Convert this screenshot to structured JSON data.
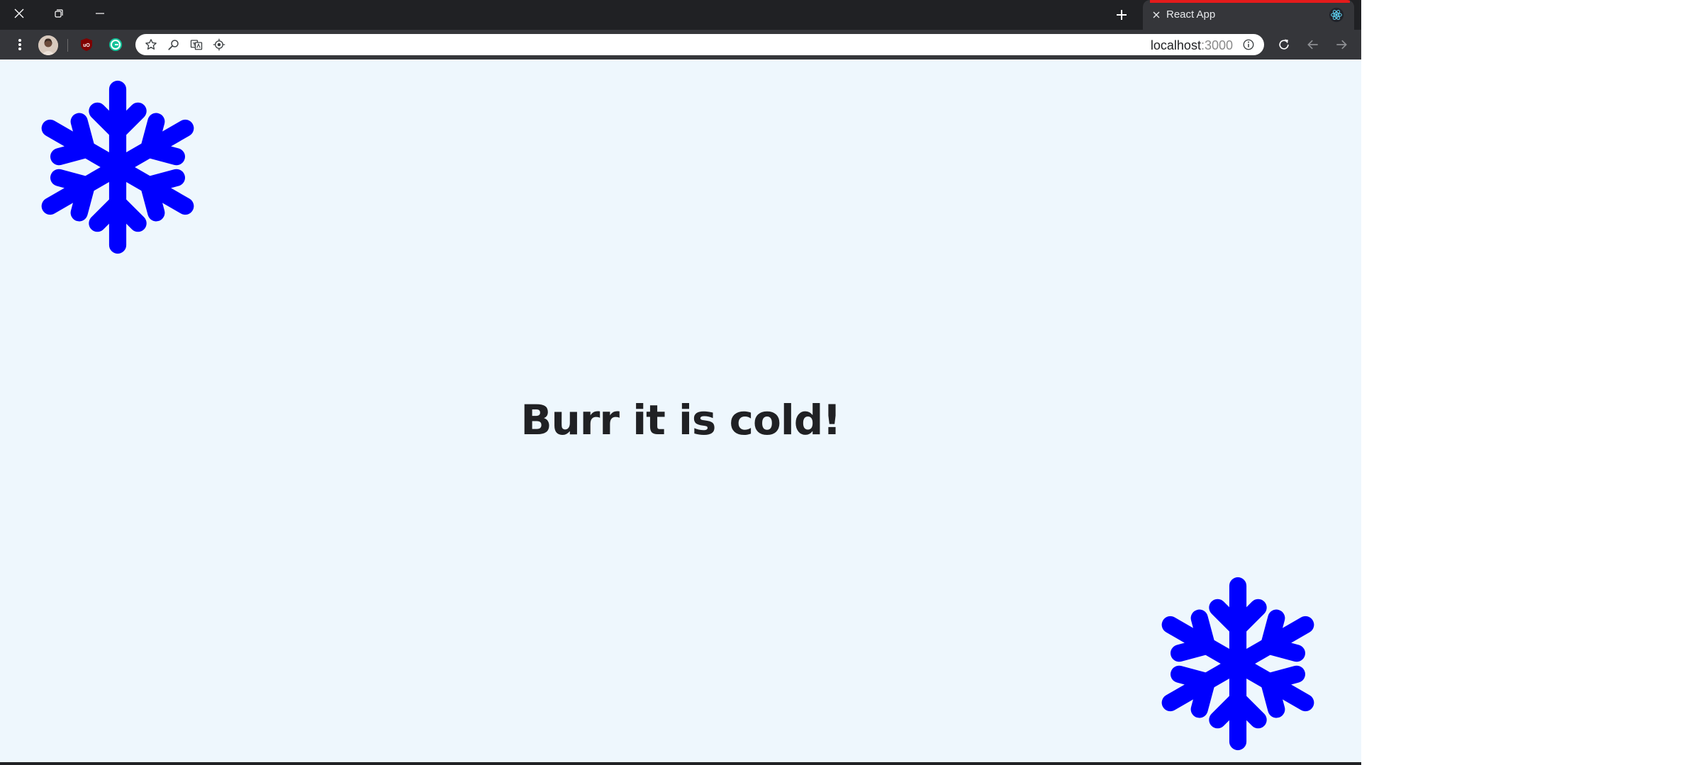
{
  "window": {
    "controls": {
      "close_icon": "close-icon",
      "restore_icon": "restore-icon",
      "minimize_icon": "minimize-icon"
    }
  },
  "tabs": [
    {
      "title": "React App",
      "favicon": "react-icon",
      "active": true
    }
  ],
  "toolbar": {
    "menu_icon": "kebab-menu-icon",
    "extensions": [
      "ublock-origin-icon",
      "grammarly-icon"
    ],
    "omnibox": {
      "host": "localhost",
      "port": ":3000",
      "icons": [
        "star-icon",
        "zoom-icon",
        "translate-icon",
        "location-icon",
        "site-info-icon"
      ]
    },
    "nav_icons": [
      "reload-icon",
      "back-icon",
      "forward-icon"
    ]
  },
  "page": {
    "headline": "Burr it is cold!",
    "background": "#eef7fd",
    "snowflake_color": "#0000ff",
    "snowflake_icon": "snowflake-icon"
  },
  "colors": {
    "titlebar": "#202124",
    "toolbar": "#35363a",
    "tab_accent": "#e41b1b"
  }
}
